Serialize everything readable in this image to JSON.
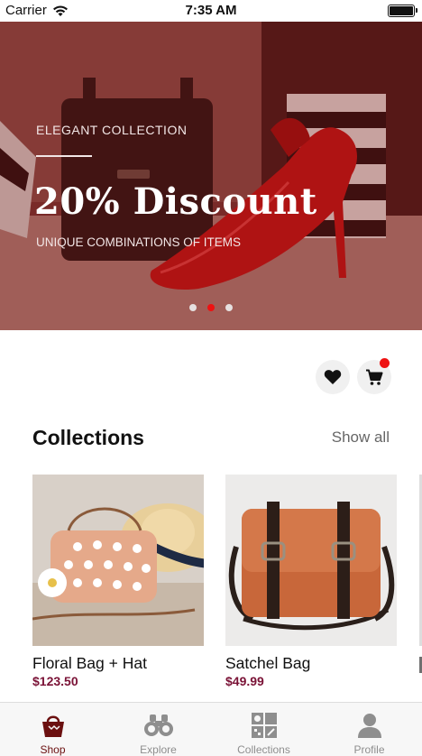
{
  "status_bar": {
    "carrier": "Carrier",
    "time": "7:35 AM"
  },
  "hero": {
    "eyebrow": "ELEGANT COLLECTION",
    "title": "20% Discount",
    "subtitle": "UNIQUE COMBINATIONS OF ITEMS",
    "slide_count": 3,
    "active_slide": 2
  },
  "actions": {
    "favorites_icon": "heart-icon",
    "cart_icon": "cart-icon",
    "cart_has_badge": true
  },
  "collections": {
    "title": "Collections",
    "show_all": "Show all",
    "items": [
      {
        "name": "Floral Bag + Hat",
        "price": "$123.50"
      },
      {
        "name": "Satchel Bag",
        "price": "$49.99"
      }
    ]
  },
  "tab_bar": {
    "tabs": [
      {
        "label": "Shop",
        "icon": "shopping-bag-icon",
        "active": true
      },
      {
        "label": "Explore",
        "icon": "binoculars-icon",
        "active": false
      },
      {
        "label": "Collections",
        "icon": "collections-grid-icon",
        "active": false
      },
      {
        "label": "Profile",
        "icon": "person-icon",
        "active": false
      }
    ]
  },
  "colors": {
    "accent": "#ee1111",
    "price": "#7a1236",
    "active_tab": "#6b1010",
    "hero_tint": "#7a2a28"
  }
}
